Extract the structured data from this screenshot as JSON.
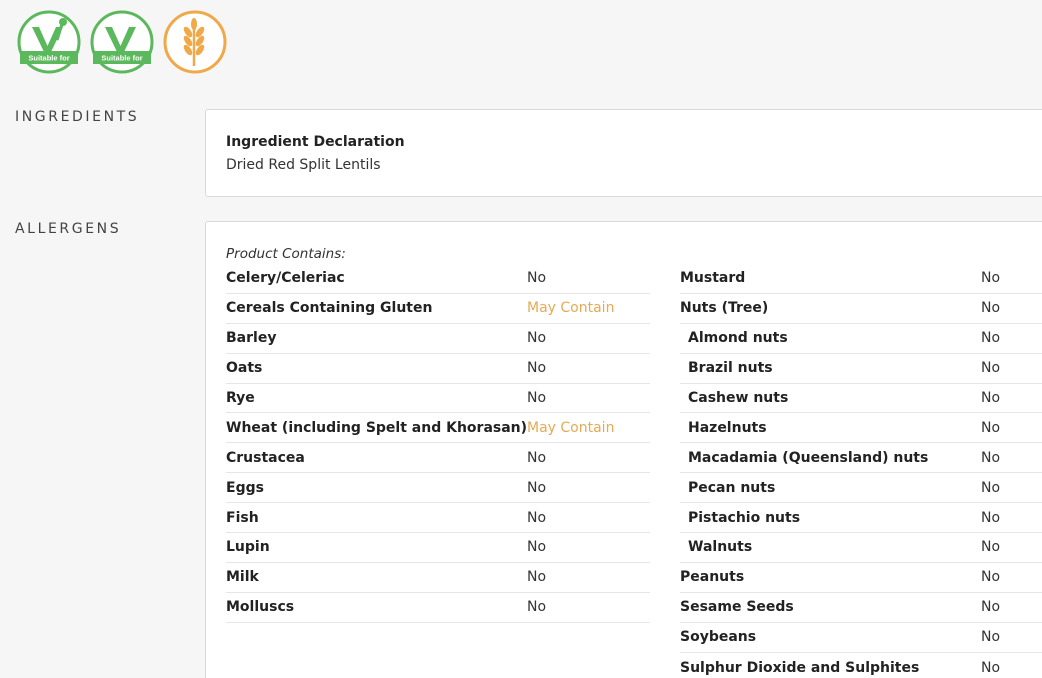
{
  "badges": [
    {
      "icon": "vegan-icon",
      "caption": "Suitable for",
      "color": "#5cb85c"
    },
    {
      "icon": "vegetarian-icon",
      "caption": "Suitable for",
      "color": "#5cb85c"
    },
    {
      "icon": "wheat-icon",
      "caption": "",
      "color": "#f0a848"
    }
  ],
  "ingredients": {
    "section_title": "INGREDIENTS",
    "heading": "Ingredient Declaration",
    "text": "Dried Red Split Lentils"
  },
  "allergens": {
    "section_title": "ALLERGENS",
    "contains_label": "Product Contains:",
    "left": [
      {
        "name": "Celery/Celeriac",
        "value": "No"
      },
      {
        "name": "Cereals Containing Gluten",
        "value": "May Contain"
      },
      {
        "name": "Barley",
        "value": "No"
      },
      {
        "name": "Oats",
        "value": "No"
      },
      {
        "name": "Rye",
        "value": "No"
      },
      {
        "name": "Wheat (including Spelt and Khorasan)",
        "value": "May Contain"
      },
      {
        "name": "Crustacea",
        "value": "No"
      },
      {
        "name": "Eggs",
        "value": "No"
      },
      {
        "name": "Fish",
        "value": "No"
      },
      {
        "name": "Lupin",
        "value": "No"
      },
      {
        "name": "Milk",
        "value": "No"
      },
      {
        "name": "Molluscs",
        "value": "No"
      }
    ],
    "right": [
      {
        "name": "Mustard",
        "value": "No"
      },
      {
        "name": "Nuts (Tree)",
        "value": "No"
      },
      {
        "name": "Almond nuts",
        "value": "No"
      },
      {
        "name": "Brazil nuts",
        "value": "No"
      },
      {
        "name": "Cashew nuts",
        "value": "No"
      },
      {
        "name": "Hazelnuts",
        "value": "No"
      },
      {
        "name": "Macadamia (Queensland) nuts",
        "value": "No"
      },
      {
        "name": "Pecan nuts",
        "value": "No"
      },
      {
        "name": "Pistachio nuts",
        "value": "No"
      },
      {
        "name": "Walnuts",
        "value": "No"
      },
      {
        "name": "Peanuts",
        "value": "No"
      },
      {
        "name": "Sesame Seeds",
        "value": "No"
      },
      {
        "name": "Soybeans",
        "value": "No"
      },
      {
        "name": "Sulphur Dioxide and Sulphites",
        "value": "No"
      }
    ]
  }
}
